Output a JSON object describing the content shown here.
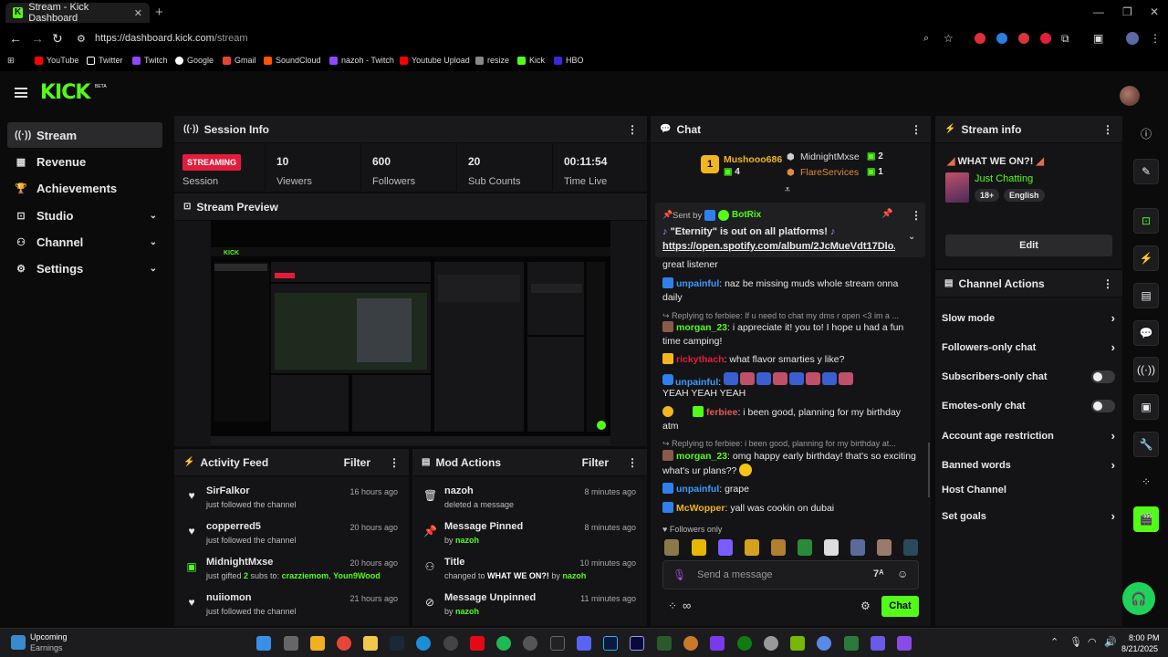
{
  "browser": {
    "tab_title": "Stream - Kick Dashboard",
    "url_host": "https://dashboard.kick.com",
    "url_path": "/stream",
    "bookmarks": [
      "YouTube",
      "Twitter",
      "Twitch",
      "Google",
      "Gmail",
      "SoundCloud",
      "nazoh - Twitch",
      "Youtube Upload",
      "resize",
      "Kick",
      "HBO"
    ]
  },
  "app": {
    "logo": "KICK",
    "beta": "BETA"
  },
  "nav": [
    {
      "label": "Stream",
      "icon": "broadcast-icon"
    },
    {
      "label": "Revenue",
      "icon": "chart-icon"
    },
    {
      "label": "Achievements",
      "icon": "trophy-icon"
    },
    {
      "label": "Studio",
      "icon": "studio-icon"
    },
    {
      "label": "Channel",
      "icon": "channel-icon"
    },
    {
      "label": "Settings",
      "icon": "gear-icon"
    }
  ],
  "session": {
    "title": "Session Info",
    "status": "STREAMING",
    "status_label": "Session",
    "stats": [
      {
        "value": "10",
        "label": "Viewers"
      },
      {
        "value": "600",
        "label": "Followers"
      },
      {
        "value": "20",
        "label": "Sub Counts"
      },
      {
        "value": "00:11:54",
        "label": "Time Live"
      }
    ]
  },
  "preview": {
    "title": "Stream Preview"
  },
  "activity": {
    "title": "Activity Feed",
    "filter": "Filter",
    "rows": [
      {
        "name": "SirFalkor",
        "text": "just followed the channel",
        "time": "16 hours ago",
        "icon": "heart-icon"
      },
      {
        "name": "copperred5",
        "text": "just followed the channel",
        "time": "20 hours ago",
        "icon": "heart-icon"
      },
      {
        "name": "MidnightMxse",
        "text_a": "just gifted ",
        "num": "2",
        "text_b": " subs to: ",
        "r1": "crazziemom",
        "sep": ", ",
        "r2": "Youn9Wood",
        "time": "20 hours ago",
        "icon": "gift-icon"
      },
      {
        "name": "nuiiomon",
        "text": "just followed the channel",
        "time": "21 hours ago",
        "icon": "heart-icon"
      }
    ]
  },
  "mod": {
    "title": "Mod Actions",
    "filter": "Filter",
    "rows": [
      {
        "name": "nazoh",
        "text": "deleted a message",
        "time": "8 minutes ago",
        "icon": "trash-icon"
      },
      {
        "name": "Message Pinned",
        "text": "by ",
        "by": "nazoh",
        "time": "8 minutes ago",
        "icon": "pin-icon"
      },
      {
        "name": "Title",
        "text": "changed to ",
        "title": "WHAT WE ON?!",
        "by_pre": " by ",
        "by": "nazoh",
        "time": "10 minutes ago",
        "icon": "user-edit-icon"
      },
      {
        "name": "Message Unpinned",
        "text": "by ",
        "by": "nazoh",
        "time": "11 minutes ago",
        "icon": "unpin-icon"
      }
    ]
  },
  "chat": {
    "title": "Chat",
    "leaders": [
      {
        "name": "Mushooo686",
        "count": "4"
      },
      {
        "name": "MidnightMxse",
        "count": "2"
      },
      {
        "name": "FlareServices",
        "count": "1"
      }
    ],
    "pinned": {
      "sent_by": "Sent by",
      "bot": "BotRix",
      "line1": "\"Eternity\" is out on all platforms!",
      "line2": "https://open.spotify.com/album/2JcMueVdt17Dlo..."
    },
    "messages": [
      {
        "text": "great listener"
      },
      {
        "user": "unpainful",
        "text": ": naz be missing muds whole stream onna daily"
      },
      {
        "reply": "Replying to ferbiee: If u need to chat my dms r open <3 im a ..."
      },
      {
        "user": "morgan_23",
        "text": ": i appreciate it! you to! I hope u had a fun time camping!"
      },
      {
        "user": "rickythach",
        "text": ": what flavor smarties y like?"
      },
      {
        "user": "unpainful",
        "text": ":"
      },
      {
        "text": "YEAH YEAH YEAH"
      },
      {
        "user": "ferbiee",
        "text": ": i been good, planning for my birthday atm"
      },
      {
        "reply": "Replying to ferbiee: i been good, planning for my birthday at..."
      },
      {
        "user": "morgan_23",
        "text": ": omg happy early birthday! that's so exciting what's ur plans??"
      },
      {
        "user": "unpainful",
        "text": ": grape"
      },
      {
        "user": "McWopper",
        "text": ": yall was cookin on dubai"
      }
    ],
    "followers_only": "Followers only",
    "input_placeholder": "Send a message",
    "send": "Chat"
  },
  "streaminfo": {
    "title": "Stream info",
    "stream_title": "WHAT WE ON?!",
    "category": "Just Chatting",
    "tags": [
      "18+",
      "English"
    ],
    "edit": "Edit"
  },
  "channel_actions": {
    "title": "Channel Actions",
    "items": [
      {
        "label": "Slow mode",
        "kind": "arrow"
      },
      {
        "label": "Followers-only chat",
        "kind": "arrow"
      },
      {
        "label": "Subscribers-only chat",
        "kind": "toggle"
      },
      {
        "label": "Emotes-only chat",
        "kind": "toggle"
      },
      {
        "label": "Account age restriction",
        "kind": "arrow"
      },
      {
        "label": "Banned words",
        "kind": "arrow"
      },
      {
        "label": "Host Channel",
        "kind": "none"
      },
      {
        "label": "Set goals",
        "kind": "arrow"
      }
    ]
  },
  "taskbar": {
    "weather_title": "Upcoming",
    "weather_sub": "Earnings",
    "time": "8:00 PM",
    "date": "8/21/2025"
  },
  "colors": {
    "accent": "#53fc18",
    "streaming": "#e21d3b",
    "panel": "#141416"
  }
}
